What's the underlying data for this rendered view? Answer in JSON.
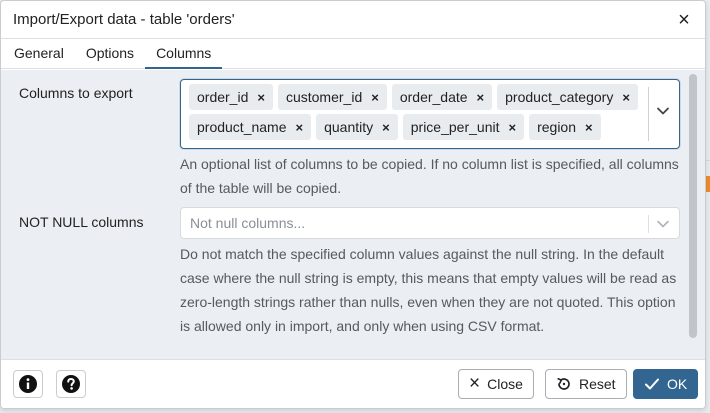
{
  "dialog": {
    "title": "Import/Export data - table 'orders'",
    "close_glyph": "×"
  },
  "tabs": [
    {
      "label": "General",
      "active": false
    },
    {
      "label": "Options",
      "active": false
    },
    {
      "label": "Columns",
      "active": true
    }
  ],
  "columns_to_export": {
    "label": "Columns to export",
    "selected": [
      "order_id",
      "customer_id",
      "order_date",
      "product_category",
      "product_name",
      "quantity",
      "price_per_unit",
      "region"
    ],
    "remove_glyph": "×",
    "help": "An optional list of columns to be copied. If no column list is specified, all columns of the table will be copied."
  },
  "not_null_columns": {
    "label": "NOT NULL columns",
    "placeholder": "Not null columns...",
    "help": "Do not match the specified column values against the null string. In the default case where the null string is empty, this means that empty values will be read as zero-length strings rather than nulls, even when they are not quoted. This option is allowed only in import, and only when using CSV format."
  },
  "footer": {
    "info_icon": "info-icon",
    "help_icon": "help-icon",
    "close_label": "Close",
    "reset_label": "Reset",
    "ok_label": "OK"
  },
  "colors": {
    "accent": "#326690",
    "chip_bg": "#e9ecef",
    "panel_bg": "#ebeef2"
  }
}
